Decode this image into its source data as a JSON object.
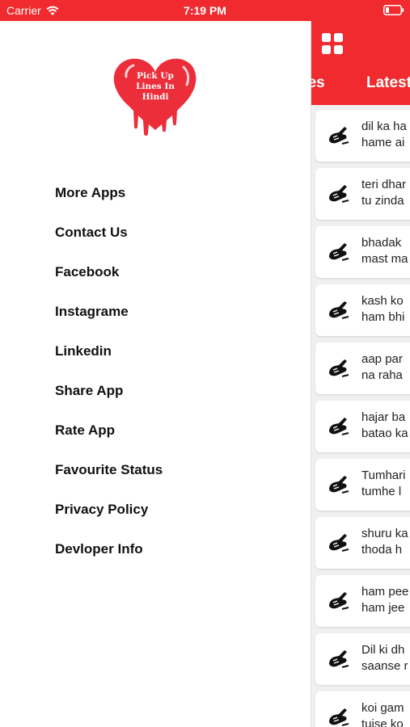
{
  "status_bar": {
    "carrier": "Carrier",
    "time": "7:19 PM"
  },
  "header": {
    "tabs": [
      {
        "label": "kes"
      },
      {
        "label": "Latest"
      }
    ]
  },
  "logo": {
    "line1": "Pick Up",
    "line2": "Lines In",
    "line3": "Hindi"
  },
  "drawer": {
    "menu": [
      {
        "label": "More Apps"
      },
      {
        "label": "Contact Us"
      },
      {
        "label": "Facebook"
      },
      {
        "label": "Instagrame"
      },
      {
        "label": "Linkedin"
      },
      {
        "label": "Share App"
      },
      {
        "label": "Rate App"
      },
      {
        "label": "Favourite Status"
      },
      {
        "label": "Privacy Policy"
      },
      {
        "label": "Devloper Info"
      }
    ]
  },
  "list": {
    "items": [
      {
        "line1": "dil ka ha",
        "line2": "hame ai"
      },
      {
        "line1": "teri dhar",
        "line2": "tu zinda"
      },
      {
        "line1": "bhadak",
        "line2": "mast ma"
      },
      {
        "line1": "kash ko",
        "line2": "ham bhi"
      },
      {
        "line1": "aap par",
        "line2": "na raha"
      },
      {
        "line1": "hajar ba",
        "line2": "batao ka"
      },
      {
        "line1": "Tumhari",
        "line2": " tumhe l"
      },
      {
        "line1": "shuru ka",
        "line2": " thoda h"
      },
      {
        "line1": "ham pee",
        "line2": "ham jee"
      },
      {
        "line1": "Dil ki dh",
        "line2": "saanse r"
      },
      {
        "line1": "koi gam",
        "line2": "tujse ko"
      }
    ]
  },
  "colors": {
    "accent": "#f02a2e",
    "drawer_bg": "#ffffff",
    "list_bg": "#f0f0f0"
  },
  "icons": {
    "status": [
      "wifi-icon",
      "battery-icon"
    ],
    "header": "grid-icon",
    "list_item": "writing-hand-icon"
  }
}
